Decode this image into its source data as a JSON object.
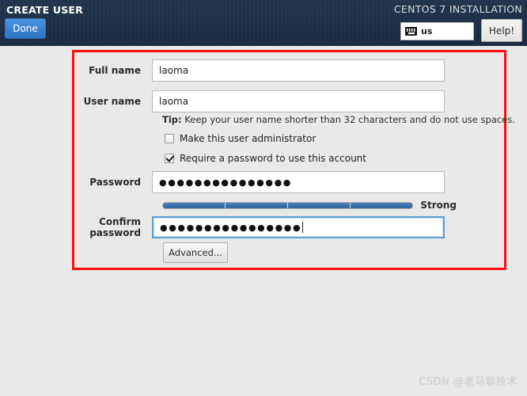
{
  "header": {
    "screen_title": "CREATE USER",
    "done_label": "Done",
    "install_title": "CENTOS 7 INSTALLATION",
    "keyboard_layout": "us",
    "keyboard_icon": "keyboard-icon",
    "help_label": "Help!"
  },
  "form": {
    "full_name": {
      "label": "Full name",
      "value": "laoma"
    },
    "user_name": {
      "label": "User name",
      "value": "laoma"
    },
    "tip_prefix": "Tip:",
    "tip_text": " Keep your user name shorter than 32 characters and do not use spaces.",
    "admin_checkbox": {
      "label": "Make this user administrator",
      "checked": false
    },
    "require_password_checkbox": {
      "label": "Require a password to use this account",
      "checked": true
    },
    "password": {
      "label": "Password",
      "masked_value": "●●●●●●●●●●●●●●●"
    },
    "confirm_password": {
      "label": "Confirm password",
      "masked_value": "●●●●●●●●●●●●●●●●",
      "focused": true
    },
    "strength": {
      "text": "Strong",
      "percent": 100,
      "segments": 4
    },
    "advanced_label": "Advanced..."
  },
  "watermark": "CSDN @老马聊技术",
  "colors": {
    "header_bg": "#1f2f47",
    "done_button": "#3a82cf",
    "highlight_border": "#fb0f0f",
    "meter_fill": "#3a6ea8",
    "focus_border": "#5b9bd5"
  }
}
